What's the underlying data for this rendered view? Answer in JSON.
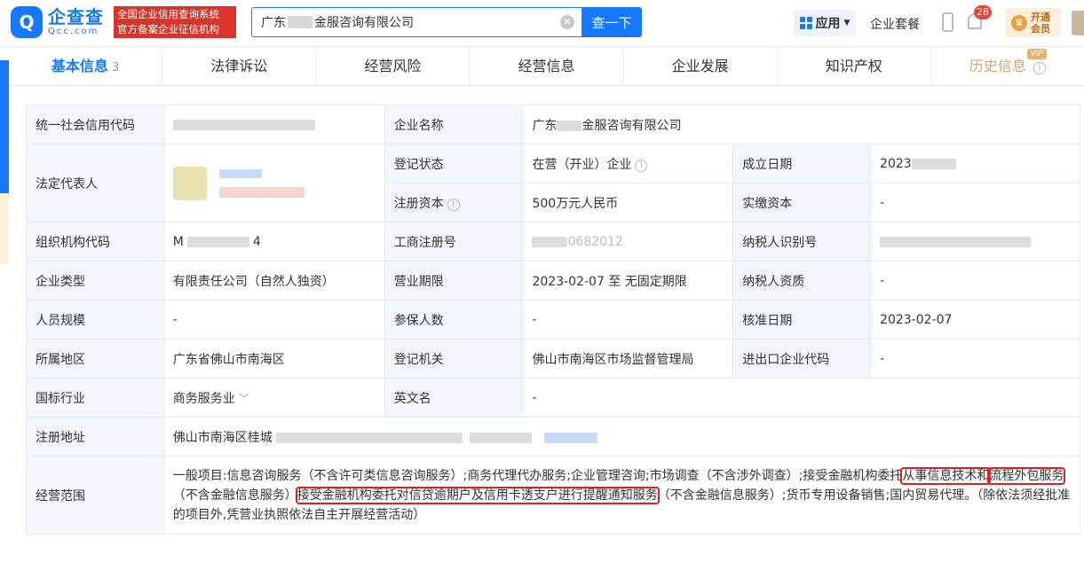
{
  "header": {
    "logo_mark": "Q",
    "logo_name": "企查查",
    "logo_domain": "Qcc.com",
    "slogan_line1": "全国企业信用查询系统",
    "slogan_line2": "官方备案企业征信机构",
    "search_value_prefix": "广东",
    "search_value_suffix": "金服咨询有限公司",
    "search_button": "查一下",
    "apps_label": "应用",
    "suite_label": "企业套餐",
    "notification_count": "28",
    "vip_line1": "开通",
    "vip_line2": "会员"
  },
  "tabs": [
    {
      "label": "基本信息",
      "count": "3"
    },
    {
      "label": "法律诉讼"
    },
    {
      "label": "经营风险"
    },
    {
      "label": "经营信息"
    },
    {
      "label": "企业发展"
    },
    {
      "label": "知识产权"
    },
    {
      "label": "历史信息",
      "badge": "VIP"
    }
  ],
  "info": {
    "credit_code_label": "统一社会信用代码",
    "company_name_label": "企业名称",
    "company_name_prefix": "广东",
    "company_name_suffix": "金服咨询有限公司",
    "legal_rep_label": "法定代表人",
    "reg_status_label": "登记状态",
    "reg_status_value": "在营（开业）企业",
    "founded_label": "成立日期",
    "founded_value": "2023",
    "reg_capital_label": "注册资本",
    "reg_capital_value": "500万元人民币",
    "paid_capital_label": "实缴资本",
    "paid_capital_value": "-",
    "org_code_label": "组织机构代码",
    "org_code_prefix": "M",
    "org_code_suffix": "4",
    "biz_reg_no_label": "工商注册号",
    "biz_reg_no_value": "0682012",
    "taxpayer_id_label": "纳税人识别号",
    "company_type_label": "企业类型",
    "company_type_value": "有限责任公司（自然人独资）",
    "biz_term_label": "营业期限",
    "biz_term_value": "2023-02-07 至 无固定期限",
    "taxpayer_qual_label": "纳税人资质",
    "taxpayer_qual_value": "-",
    "staff_size_label": "人员规模",
    "staff_size_value": "-",
    "insured_label": "参保人数",
    "insured_value": "-",
    "approval_date_label": "核准日期",
    "approval_date_value": "2023-02-07",
    "region_label": "所属地区",
    "region_value": "广东省佛山市南海区",
    "reg_authority_label": "登记机关",
    "reg_authority_value": "佛山市南海区市场监督管理局",
    "import_export_label": "进出口企业代码",
    "import_export_value": "-",
    "industry_label": "国标行业",
    "industry_value": "商务服务业",
    "english_name_label": "英文名",
    "english_name_value": "-",
    "reg_address_label": "注册地址",
    "reg_address_value": "佛山市南海区桂城",
    "scope_label": "经营范围",
    "scope_part1": "一般项目:信息咨询服务（不含许可类信息咨询服务）;商务代理代办服务;企业管理咨询;市场调查（不含涉外调查）;接受金融机构委托",
    "scope_hl1": "从事信息技术和",
    "scope_hl2": "流程外包服务",
    "scope_part2": "（不含金融信息服务）",
    "scope_hl3": "接受金融机构委托对信贷逾期户及信用卡透支户进行提醒通知服务",
    "scope_part3": "（不含金融信息服务）;货币专用设备销售;国内贸易代理。（除依法须经批准的项目外,凭营业执照依法自主开展经营活动）"
  }
}
